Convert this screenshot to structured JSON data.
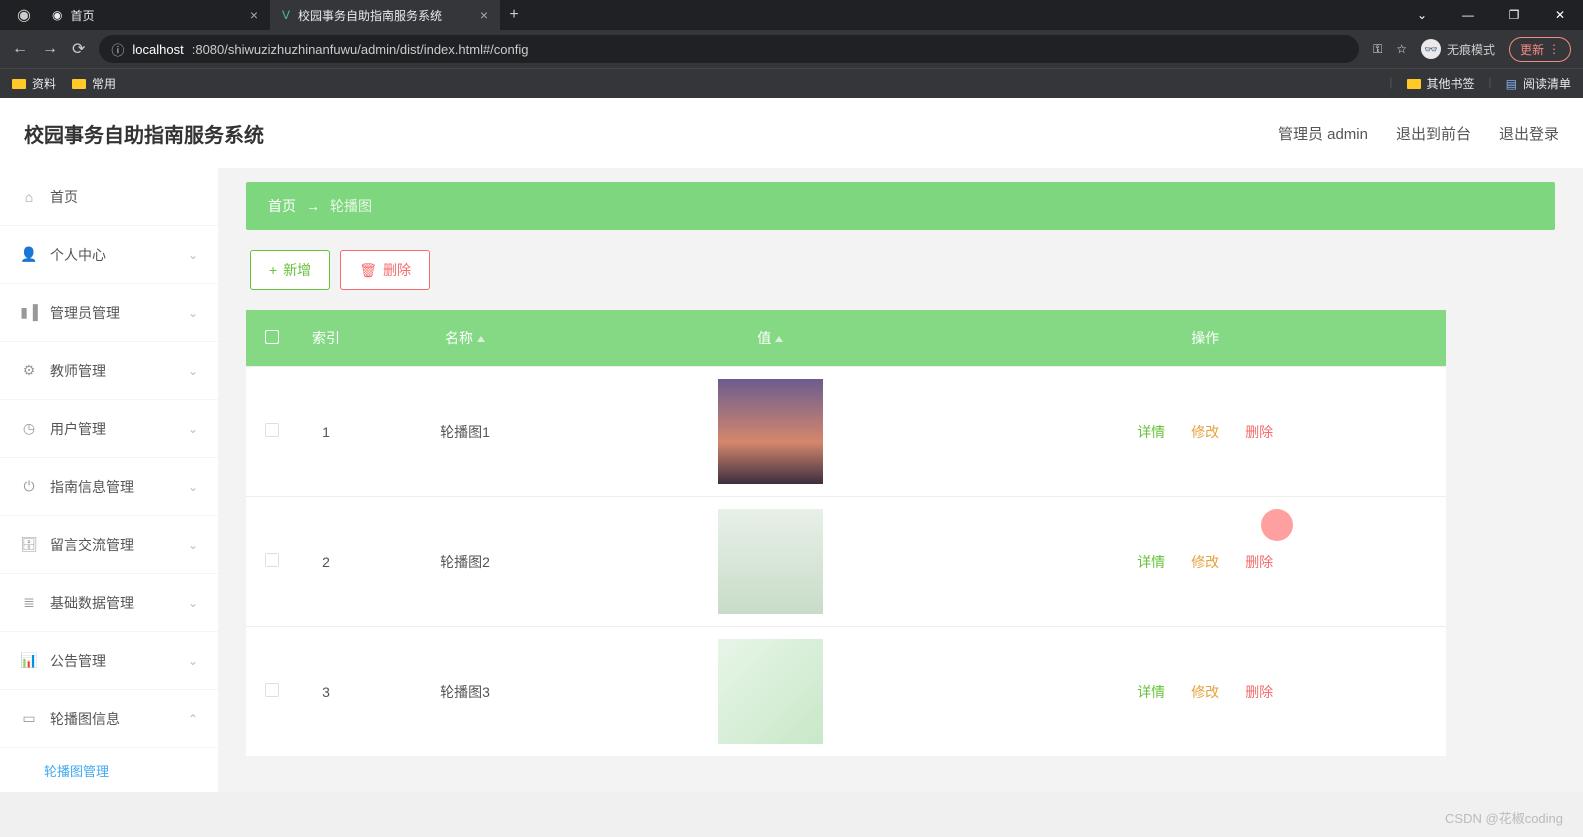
{
  "browser": {
    "tabs": [
      {
        "title": "首页"
      },
      {
        "title": "校园事务自助指南服务系统"
      }
    ],
    "url_host": "localhost",
    "url_path": ":8080/shiwuzizhuzhinanfuwu/admin/dist/index.html#/config",
    "incognito_label": "无痕模式",
    "update_label": "更新",
    "bookmarks": [
      "资料",
      "常用"
    ],
    "other_bookmarks": "其他书签",
    "reading_list": "阅读清单"
  },
  "app": {
    "title": "校园事务自助指南服务系统",
    "header_links": {
      "user": "管理员 admin",
      "front": "退出到前台",
      "logout": "退出登录"
    },
    "sidebar": [
      {
        "icon": "home",
        "label": "首页",
        "expand": null
      },
      {
        "icon": "user",
        "label": "个人中心",
        "expand": "down"
      },
      {
        "icon": "bar",
        "label": "管理员管理",
        "expand": "down"
      },
      {
        "icon": "gear",
        "label": "教师管理",
        "expand": "down"
      },
      {
        "icon": "clock",
        "label": "用户管理",
        "expand": "down"
      },
      {
        "icon": "power",
        "label": "指南信息管理",
        "expand": "down"
      },
      {
        "icon": "desk",
        "label": "留言交流管理",
        "expand": "down"
      },
      {
        "icon": "layers",
        "label": "基础数据管理",
        "expand": "down"
      },
      {
        "icon": "stats",
        "label": "公告管理",
        "expand": "down"
      },
      {
        "icon": "image",
        "label": "轮播图信息",
        "expand": "up"
      }
    ],
    "sidebar_sub": "轮播图管理",
    "breadcrumb": {
      "home": "首页",
      "current": "轮播图"
    },
    "actions": {
      "add": "新增",
      "delete": "删除"
    },
    "table": {
      "headers": {
        "index": "索引",
        "name": "名称",
        "value": "值",
        "ops": "操作"
      },
      "rows": [
        {
          "index": "1",
          "name": "轮播图1"
        },
        {
          "index": "2",
          "name": "轮播图2"
        },
        {
          "index": "3",
          "name": "轮播图3"
        }
      ],
      "ops": {
        "detail": "详情",
        "edit": "修改",
        "delete": "删除"
      }
    }
  },
  "watermark": "CSDN @花椒coding"
}
